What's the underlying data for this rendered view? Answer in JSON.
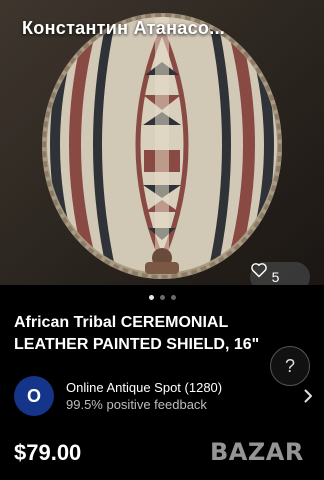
{
  "listing": {
    "header_title": "Константин Атанасо...",
    "photo_count": "5",
    "title_line1": "African Tribal CEREMONIAL",
    "title_line2": "LEATHER PAINTED SHIELD, 16\"",
    "price": "$79.00"
  },
  "carousel": {
    "total_dots": 3,
    "active_index": 0
  },
  "help": {
    "label": "?"
  },
  "seller": {
    "avatar_letter": "O",
    "name": "Online Antique Spot (1280)",
    "feedback": "99.5% positive feedback"
  },
  "watermark": {
    "text": "BAZAR"
  },
  "colors": {
    "background": "#000000",
    "avatar": "#14358a",
    "shield_leather": "#d2c8b6",
    "shield_red": "#8a4a44",
    "shield_dark": "#2f3338"
  },
  "icons": {
    "heart": "heart-icon",
    "chevron": "chevron-right-icon"
  }
}
